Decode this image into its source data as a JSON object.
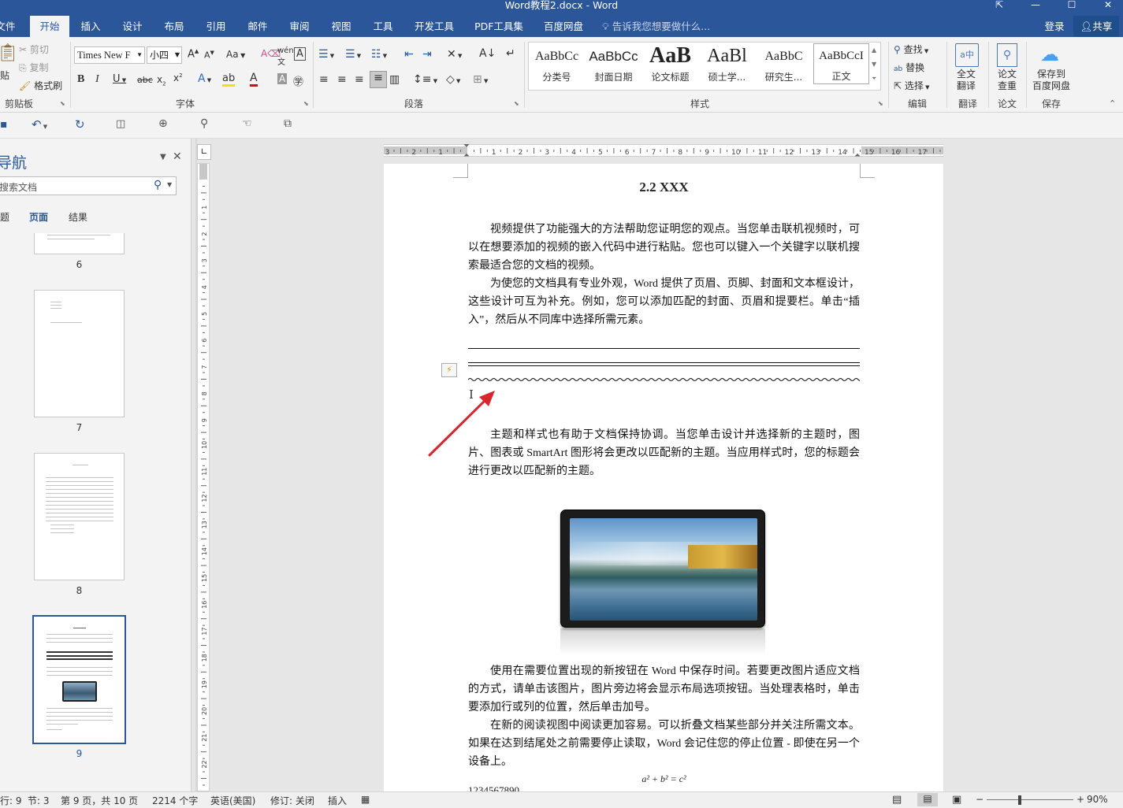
{
  "title": "Word教程2.docx - Word",
  "tabs": [
    "文件",
    "开始",
    "插入",
    "设计",
    "布局",
    "引用",
    "邮件",
    "审阅",
    "视图",
    "工具",
    "开发工具",
    "PDF工具集",
    "百度网盘"
  ],
  "tell_me": "告诉我您想要做什么...",
  "login": "登录",
  "share": "共享",
  "clipboard": {
    "cut": "剪切",
    "copy": "复制",
    "format_painter": "格式刷",
    "paste": "贴",
    "label": "剪贴板"
  },
  "font": {
    "name": "Times New F",
    "size": "小四",
    "label": "字体",
    "aa": "Aa"
  },
  "paragraph_label": "段落",
  "styles": {
    "items": [
      {
        "sample": "AaBbCc",
        "name": "分类号"
      },
      {
        "sample": "AaBbCc",
        "name": "封面日期"
      },
      {
        "sample": "AaB",
        "name": "论文标题"
      },
      {
        "sample": "AaBl",
        "name": "硕士学..."
      },
      {
        "sample": "AaBbC",
        "name": "研究生..."
      },
      {
        "sample": "AaBbCcI",
        "name": "正文"
      }
    ],
    "label": "样式"
  },
  "editing": {
    "find": "查找",
    "replace": "替换",
    "select": "选择",
    "label": "编辑"
  },
  "translate": {
    "btn1": "全文",
    "btn2": "翻译",
    "label": "翻译"
  },
  "paper": {
    "btn1": "论文",
    "btn2": "查重",
    "label": "论文"
  },
  "save": {
    "btn1": "保存到",
    "btn2": "百度网盘",
    "label": "保存"
  },
  "nav": {
    "title": "导航",
    "search_placeholder": "搜索文档",
    "tabs": [
      "标题",
      "页面",
      "结果"
    ],
    "pages": [
      "6",
      "7",
      "8",
      "9"
    ]
  },
  "doc": {
    "heading": "2.2 XXX",
    "p1": "视频提供了功能强大的方法帮助您证明您的观点。当您单击联机视频时，可以在想要添加的视频的嵌入代码中进行粘贴。您也可以键入一个关键字以联机搜索最适合您的文档的视频。",
    "p2": "为使您的文档具有专业外观，Word 提供了页眉、页脚、封面和文本框设计，这些设计可互为补充。例如，您可以添加匹配的封面、页眉和提要栏。单击“插入”，然后从不同库中选择所需元素。",
    "p3": "主题和样式也有助于文档保持协调。当您单击设计并选择新的主题时，图片、图表或 SmartArt 图形将会更改以匹配新的主题。当应用样式时，您的标题会进行更改以匹配新的主题。",
    "p4": "使用在需要位置出现的新按钮在 Word 中保存时间。若要更改图片适应文档的方式，请单击该图片，图片旁边将会显示布局选项按钮。当处理表格时，单击要添加行或列的位置，然后单击加号。",
    "p5": "在新的阅读视图中阅读更加容易。可以折叠文档某些部分并关注所需文本。如果在达到结尾处之前需要停止读取，Word 会记住您的停止位置 - 即使在另一个设备上。",
    "formula": "a² + b² = c²",
    "last_line": "1234567890"
  },
  "status": {
    "row": "行: 9",
    "section": "节: 3",
    "page": "第 9 页，共 10 页",
    "words": "2214 个字",
    "lang": "英语(美国)",
    "revision": "修订: 关闭",
    "insert": "插入",
    "zoom": "90%"
  },
  "colors": {
    "brand": "#2b579a",
    "arrow": "#d9262e"
  }
}
